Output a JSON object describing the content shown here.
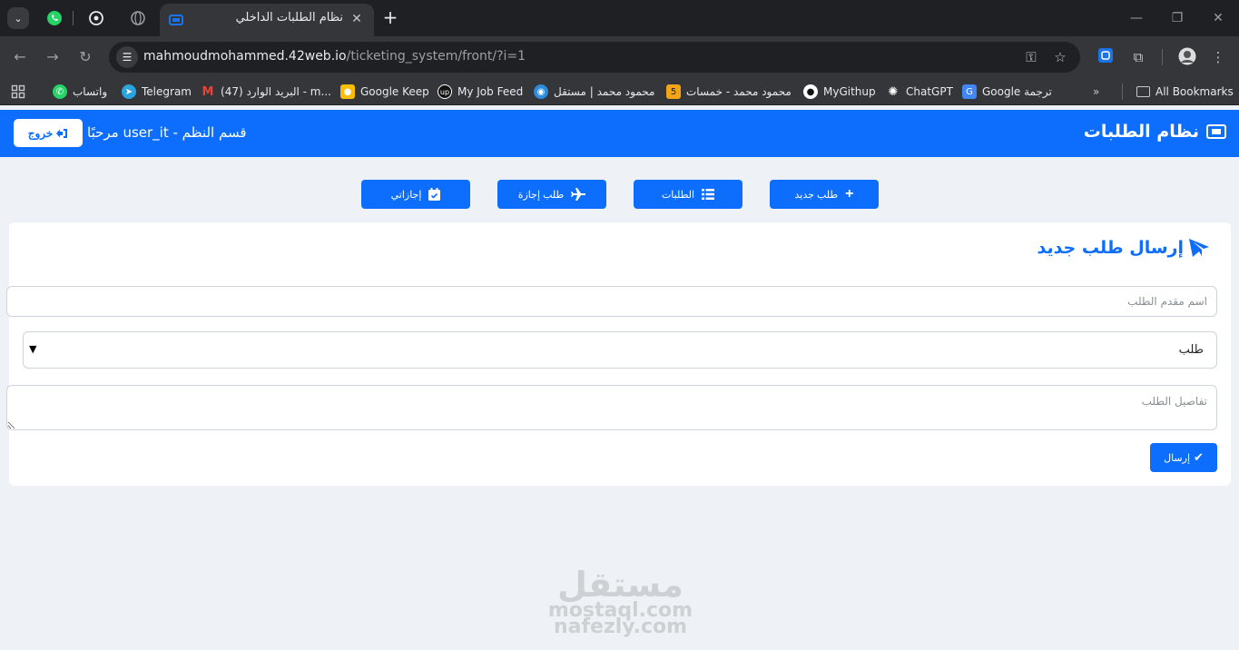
{
  "browser": {
    "active_tab_title": "نظام الطلبات الداخلي",
    "url_host": "mahmoudmohammed.42web.io",
    "url_path": "/ticketing_system/front/?i=1",
    "bookmarks": [
      {
        "label": "واتساب",
        "icon": "whatsapp-icon",
        "color": "#25d366"
      },
      {
        "label": "Telegram",
        "icon": "telegram-icon",
        "color": "#2aa3df"
      },
      {
        "label": "البريد الوارد (47) - m...",
        "icon": "gmail-icon",
        "color": "#ea4335"
      },
      {
        "label": "Google Keep",
        "icon": "keep-icon",
        "color": "#fbbc04"
      },
      {
        "label": "My Job Feed",
        "icon": "upwork-icon",
        "color": "#111111"
      },
      {
        "label": "محمود محمد | مستقل",
        "icon": "mostaql-icon",
        "color": "#2d8cdb"
      },
      {
        "label": "محمود محمد - خمسات",
        "icon": "khamsat-icon",
        "color": "#f2a516"
      },
      {
        "label": "MyGithup",
        "icon": "github-icon",
        "color": "#ffffff"
      },
      {
        "label": "ChatGPT",
        "icon": "chatgpt-icon",
        "color": "#ffffff"
      },
      {
        "label": "Google ترجمة",
        "icon": "translate-icon",
        "color": "#4285f4"
      }
    ],
    "all_bookmarks": "All Bookmarks"
  },
  "header": {
    "brand": "نظام الطلبات",
    "welcome": "مرحبًا user_it - قسم النظم",
    "logout": "خروج"
  },
  "nav": {
    "new_request": "طلب جديد",
    "requests": "الطلبات",
    "leave_request": "طلب إجازة",
    "my_leaves": "إجازاتي"
  },
  "form": {
    "title": "إرسال طلب جديد",
    "name_placeholder": "اسم مقدم الطلب",
    "type_value": "طلب",
    "details_placeholder": "تفاصيل الطلب",
    "submit": "إرسال"
  },
  "watermark": {
    "arabic": "مستقل",
    "latin_1": "mostaql.com",
    "latin_2": "nafezly.com"
  },
  "colors": {
    "primary": "#0d6efd",
    "page_bg": "#eef1f5"
  }
}
